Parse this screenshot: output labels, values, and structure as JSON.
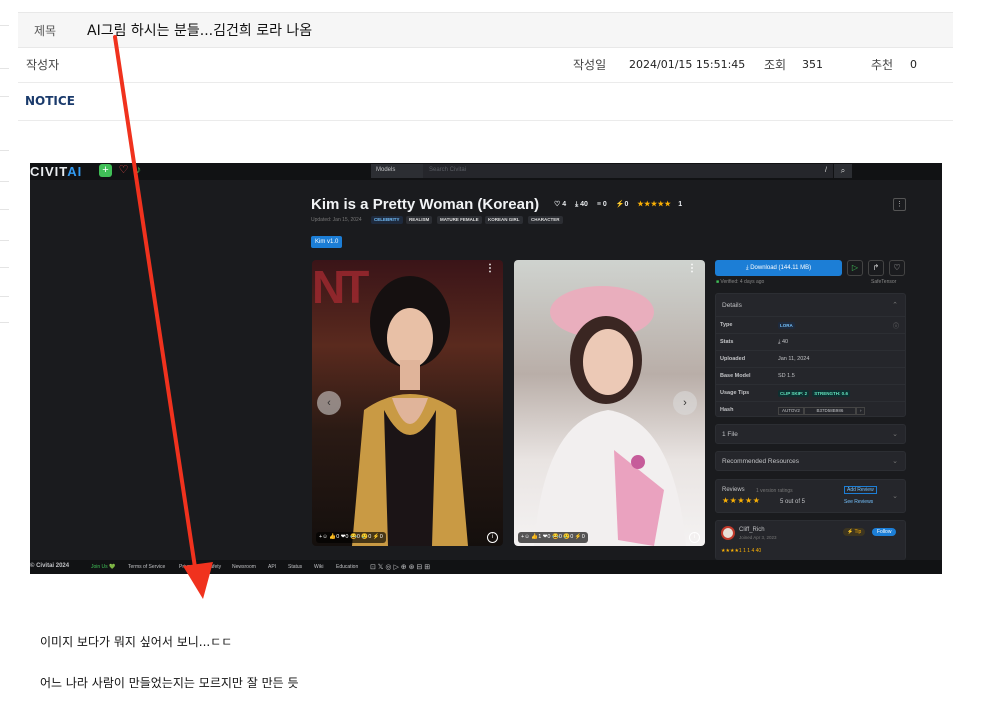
{
  "post": {
    "title_label": "제목",
    "title": "AI그림 하시는 분들...김건희 로라 나옴",
    "author_label": "작성자",
    "date_label": "작성일",
    "date": "2024/01/15 15:51:45",
    "views_label": "조회",
    "views": "351",
    "recommend_label": "추천",
    "recommend": "0",
    "notice": "NOTICE"
  },
  "screenshot": {
    "logo_main": "CIVIT",
    "logo_ai": "AI",
    "search_select": "Models",
    "search_placeholder": "Search Civitai",
    "search_slash": "/",
    "model_title": "Kim is a Pretty Woman (Korean)",
    "stats": {
      "likes": "4",
      "downloads": "40",
      "comments": "0",
      "buzz": "0",
      "rating_count": "1"
    },
    "updated": "Updated: Jan 15, 2024",
    "tags": [
      "CELEBRITY",
      "REALISM",
      "MATURE FEMALE",
      "KOREAN GIRL",
      "CHARACTER"
    ],
    "version": "Kim v1.0",
    "image1_overlay": "NT",
    "image1_reactions": "+☺ 👍0 ❤0 😂0 😢0 ⚡0",
    "image2_reactions": "+☺ 👍1 ❤0 😂0 😢0 ⚡0",
    "download_label": "Download (144.11 MB)",
    "verified_text": "Verified: 4 days ago",
    "safetensor": "SafeTensor",
    "details": {
      "header": "Details",
      "type_k": "Type",
      "type_v": "LORA",
      "stats_k": "Stats",
      "stats_v": "40",
      "uploaded_k": "Uploaded",
      "uploaded_v": "Jan 11, 2024",
      "base_k": "Base Model",
      "base_v": "SD 1.5",
      "tips_k": "Usage Tips",
      "tips_v1": "CLIP SKIP: 2",
      "tips_v2": "STRENGTH: 0.6",
      "hash_k": "Hash",
      "hash_v1": "AUTOV2",
      "hash_v2": "B37D58B986"
    },
    "files_label": "1 File",
    "recommended_label": "Recommended Resources",
    "reviews": {
      "label": "Reviews",
      "version_ratings": "1 version ratings",
      "add_review": "Add Review",
      "stars": "★★★★★",
      "score": "5 out of 5",
      "see_reviews": "See Reviews"
    },
    "creator": {
      "name": "Cliff_Rich",
      "joined": "Joined Apr 3, 2023",
      "tip": "Tip",
      "follow": "Follow",
      "stats": "★★★★1  1  1  4  40"
    },
    "footer": [
      "© Civitai 2024",
      "Join Us 💚",
      "Terms of Service",
      "Privacy",
      "Safety",
      "Newsroom",
      "API",
      "Status",
      "Wiki",
      "Education"
    ]
  },
  "body": {
    "line1": "이미지 보다가 뭐지 싶어서 보니...ㄷㄷ",
    "line2": "어느 나라 사람이 만들었는지는 모르지만 잘 만든 듯"
  },
  "colors": {
    "annotation_arrow": "#f0321e",
    "civitai_blue": "#1c7ed6",
    "notice": "#1a3a6b"
  }
}
